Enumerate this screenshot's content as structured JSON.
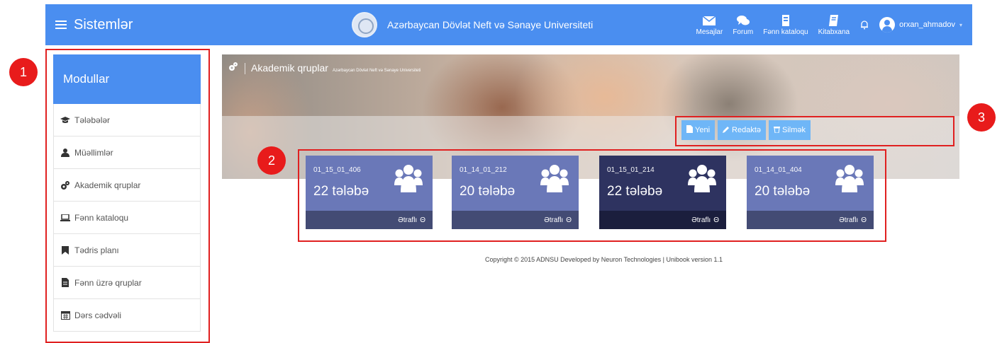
{
  "navbar": {
    "brand": "Sistemlər",
    "university": "Azərbaycan Dövlət Neft və Sənaye Universiteti",
    "items": [
      {
        "label": "Mesajlar",
        "icon": "envelope-icon"
      },
      {
        "label": "Forum",
        "icon": "chat-icon"
      },
      {
        "label": "Fənn kataloqu",
        "icon": "book-stack-icon"
      },
      {
        "label": "Kitabxana",
        "icon": "book-icon"
      }
    ],
    "username": "orxan_ahmadov"
  },
  "sidebar": {
    "header": "Modullar",
    "items": [
      {
        "label": "Tələbələr",
        "icon": "graduation-cap-icon"
      },
      {
        "label": "Müəllimlər",
        "icon": "user-icon"
      },
      {
        "label": "Akademik qruplar",
        "icon": "cogs-icon"
      },
      {
        "label": "Fənn kataloqu",
        "icon": "laptop-icon"
      },
      {
        "label": "Tədris planı",
        "icon": "bookmark-icon"
      },
      {
        "label": "Fənn üzrə qruplar",
        "icon": "document-icon"
      },
      {
        "label": "Dərs cədvəli",
        "icon": "calendar-icon"
      }
    ]
  },
  "page": {
    "title": "Akademik qruplar",
    "subtitle": "Azərbaycan Dövlət Neft və Sənaye Universiteti"
  },
  "actions": {
    "new": "Yeni",
    "edit": "Redaktə",
    "delete": "Silmək"
  },
  "groups": [
    {
      "code": "01_15_01_406",
      "count": "22 tələbə",
      "more": "Ətraflı",
      "color": "#6a78b8",
      "footer_color": "#434b74"
    },
    {
      "code": "01_14_01_212",
      "count": "20 tələbə",
      "more": "Ətraflı",
      "color": "#6a78b8",
      "footer_color": "#434b74"
    },
    {
      "code": "01_15_01_214",
      "count": "22 tələbə",
      "more": "Ətraflı",
      "color": "#2e3360",
      "footer_color": "#1b1e3d"
    },
    {
      "code": "01_14_01_404",
      "count": "20 tələbə",
      "more": "Ətraflı",
      "color": "#6a78b8",
      "footer_color": "#434b74"
    }
  ],
  "annotations": [
    "1",
    "2",
    "3"
  ],
  "footer": {
    "copyright": "Copyright © 2015 ADNSU Developed by Neuron Technologies | Unibook version 1.1"
  }
}
